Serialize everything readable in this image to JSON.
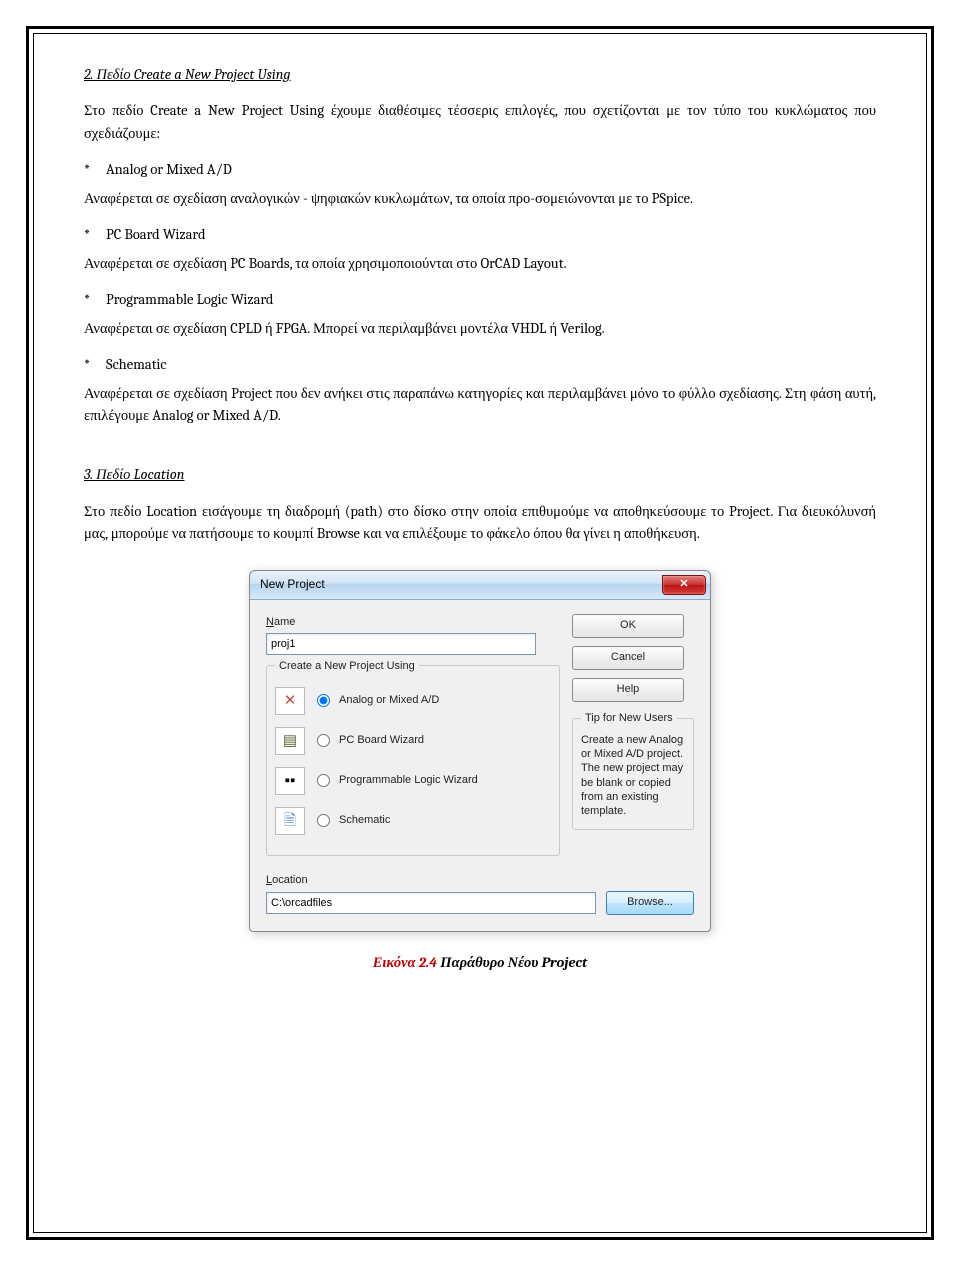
{
  "section2": {
    "heading": "2.  Πεδίο Create a New Project Using",
    "para1": "Στο πεδίο Create a New Project Using έχουμε διαθέσιμες τέσσερις επιλογές, που σχετίζονται με τον τύπο του κυκλώματος που σχεδιάζουμε:",
    "optA_label": "Analog or Mixed A/D",
    "optA_desc": "Αναφέρεται σε σχεδίαση αναλογικών - ψηφιακών κυκλωμάτων, τα οποία προ-σομειώνονται με το PSpice.",
    "optB_label": "PC Board Wizard",
    "optB_desc": "Αναφέρεται σε σχεδίαση PC Boards, τα οποία χρησιμοποιούνται στο OrCAD Layout.",
    "optC_label": "Programmable Logic Wizard",
    "optC_desc": "Αναφέρεται σε σχεδίαση CPLD ή FPGA. Μπορεί να περιλαμβάνει μοντέλα VHDL ή Verilog.",
    "optD_label": "Schematic",
    "optD_desc": "Αναφέρεται σε σχεδίαση Project που δεν ανήκει στις παραπάνω κατηγορίες και περιλαμβάνει μόνο το φύλλο σχεδίασης. Στη φάση αυτή, επιλέγουμε Analog or Mixed A/D."
  },
  "section3": {
    "heading": "3.  Πεδίο Location",
    "para1": "Στο πεδίο Location εισάγουμε τη διαδρομή (path) στο δίσκο στην οποία επιθυμούμε να αποθηκεύσουμε το Project. Για διευκόλυνσή μας, μπορούμε να πατήσουμε το κουμπί Browse και να επιλέξουμε το φάκελο όπου θα γίνει η αποθήκευση."
  },
  "dialog": {
    "title": "New Project",
    "name_label_u": "N",
    "name_label_rest": "ame",
    "name_value": "proj1",
    "group_legend": "Create a New Project Using",
    "radio1": "Analog or Mixed A/D",
    "radio2": "PC Board Wizard",
    "radio3": "Programmable Logic Wizard",
    "radio4": "Schematic",
    "radio4_u": "S",
    "radio4_rest": "chematic",
    "radio2_u": "P",
    "radio2_rest": "C Board Wizard",
    "btn_ok": "OK",
    "btn_cancel": "Cancel",
    "btn_help_u": "H",
    "btn_help_rest": "elp",
    "tip_legend": "Tip for New Users",
    "tip_text": "Create a new Analog or Mixed A/D project.  The new project may be blank or copied from an existing template.",
    "loc_label_u": "L",
    "loc_label_rest": "ocation",
    "loc_value": "C:\\orcadfiles",
    "browse_u": "B",
    "browse_rest": "rowse..."
  },
  "caption": {
    "fignum": "Εικόνα 2.4",
    "figtxt": "  Παράθυρο Νέου Project"
  }
}
